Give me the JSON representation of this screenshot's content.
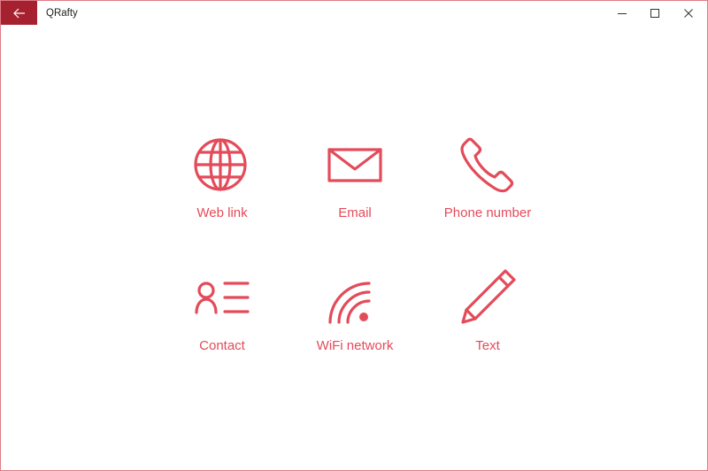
{
  "window": {
    "title": "QRafty",
    "accent_color": "#a5212f",
    "icon_color": "#e34b5a"
  },
  "titlebar": {
    "back_icon": "arrow-left-icon",
    "minimize_icon": "minimize-icon",
    "maximize_icon": "maximize-icon",
    "close_icon": "close-icon"
  },
  "tiles": [
    {
      "label": "Web link",
      "icon": "globe-icon"
    },
    {
      "label": "Email",
      "icon": "envelope-icon"
    },
    {
      "label": "Phone number",
      "icon": "phone-icon"
    },
    {
      "label": "Contact",
      "icon": "contact-card-icon"
    },
    {
      "label": "WiFi network",
      "icon": "wifi-icon"
    },
    {
      "label": "Text",
      "icon": "pencil-icon"
    }
  ]
}
